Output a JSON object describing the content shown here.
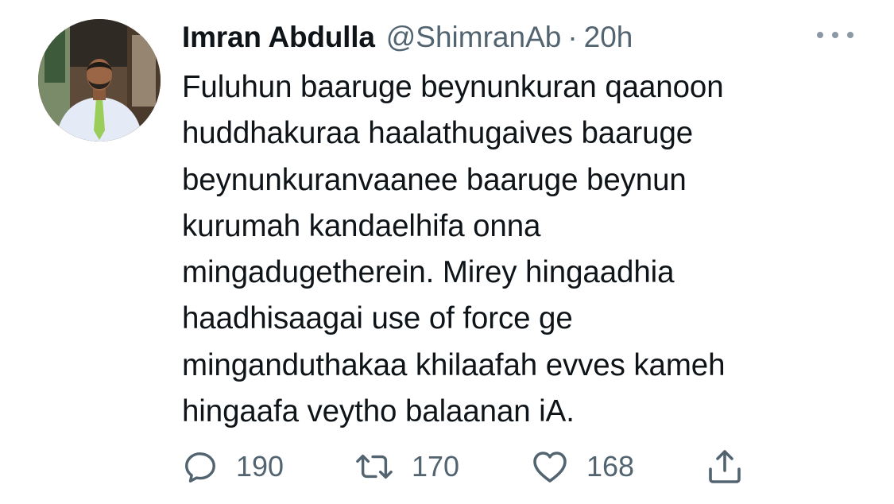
{
  "author": {
    "display_name": "Imran Abdulla",
    "handle": "@ShimranAb",
    "separator": "·",
    "time": "20h"
  },
  "tweet": {
    "lines": [
      "Fuluhun baaruge beynunkuran qaanoon",
      "huddhakuraa haalathugaives baaruge",
      "beynunkuranvaanee baaruge beynun",
      "kurumah kandaelhifa onna",
      "mingadugetherein. Mirey hingaadhia",
      "haadhisaagai use of force ge",
      "minganduthakaa khilaafah evves kameh",
      "hingaafa veytho balaanan iA."
    ]
  },
  "actions": {
    "reply": {
      "icon": "reply-icon",
      "count": "190"
    },
    "retweet": {
      "icon": "retweet-icon",
      "count": "170"
    },
    "like": {
      "icon": "heart-icon",
      "count": "168"
    },
    "share": {
      "icon": "share-icon"
    }
  },
  "more_menu": {
    "icon": "more-icon"
  },
  "colors": {
    "text_primary": "#0f1419",
    "text_secondary": "#536471",
    "icon_gray": "#536471"
  }
}
